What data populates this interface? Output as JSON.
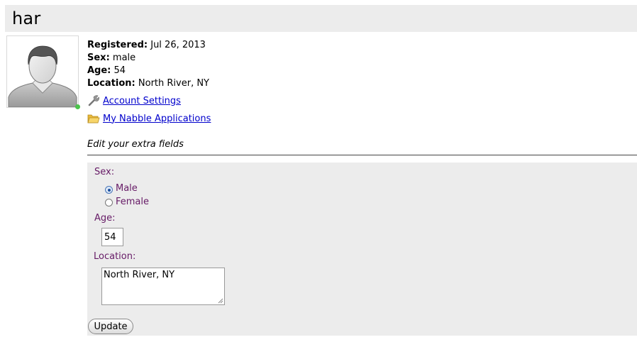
{
  "header": {
    "title": "har"
  },
  "profile": {
    "registered_label": "Registered:",
    "registered_value": "Jul 26, 2013",
    "sex_label": "Sex:",
    "sex_value": "male",
    "age_label": "Age:",
    "age_value": "54",
    "location_label": "Location:",
    "location_value": "North River, NY",
    "status": "online",
    "status_color": "#4cc44c"
  },
  "links": {
    "account_settings": {
      "label": "Account Settings",
      "icon": "wrench-icon"
    },
    "my_apps": {
      "label": "My Nabble Applications",
      "icon": "folder-icon"
    }
  },
  "edit": {
    "title": "Edit your extra fields",
    "sex_label": "Sex:",
    "sex_options": [
      "Male",
      "Female"
    ],
    "sex_selected": "Male",
    "age_label": "Age:",
    "age_value": "54",
    "location_label": "Location:",
    "location_value": "North River, NY",
    "update_label": "Update"
  },
  "colors": {
    "header_bg": "#ececec",
    "form_bg": "#ececec",
    "field_label": "#661a66",
    "link": "#0000cc"
  }
}
